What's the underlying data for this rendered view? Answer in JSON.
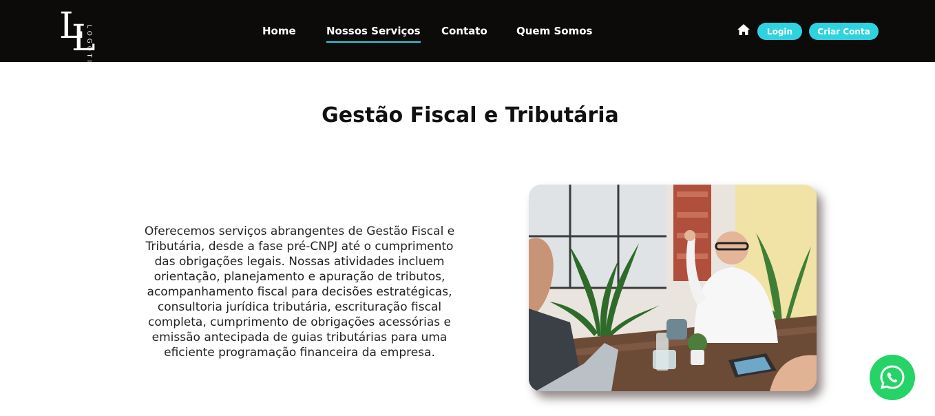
{
  "logo": {
    "letters_1": "L",
    "letters_2": "L",
    "word": "LOGOTIPO"
  },
  "nav": {
    "items": [
      {
        "label": "Home"
      },
      {
        "label": "Nossos Serviços"
      },
      {
        "label": "Contato"
      },
      {
        "label": "Quem Somos"
      }
    ],
    "active": "Nossos Serviços"
  },
  "header_actions": {
    "home_icon": "home-icon",
    "login_label": "Login",
    "signup_label": "Criar Conta"
  },
  "main": {
    "title": "Gestão Fiscal e Tributária",
    "description": "Oferecemos serviços abrangentes de Gestão Fiscal e Tributária, desde a fase pré-CNPJ até o cumprimento das obrigações legais. Nossas atividades incluem orientação, planejamento e apuração de tributos, acompanhamento fiscal para decisões estratégicas, consultoria jurídica tributária, escrituração fiscal completa, cumprimento de obrigações acessórias e emissão antecipada de guias tributárias para uma eficiente programação financeira da empresa."
  },
  "floating": {
    "whatsapp_icon": "whatsapp-icon"
  },
  "colors": {
    "topbar": "#0d0a0a",
    "accent": "#2fd3e0",
    "whatsapp": "#25d366"
  }
}
